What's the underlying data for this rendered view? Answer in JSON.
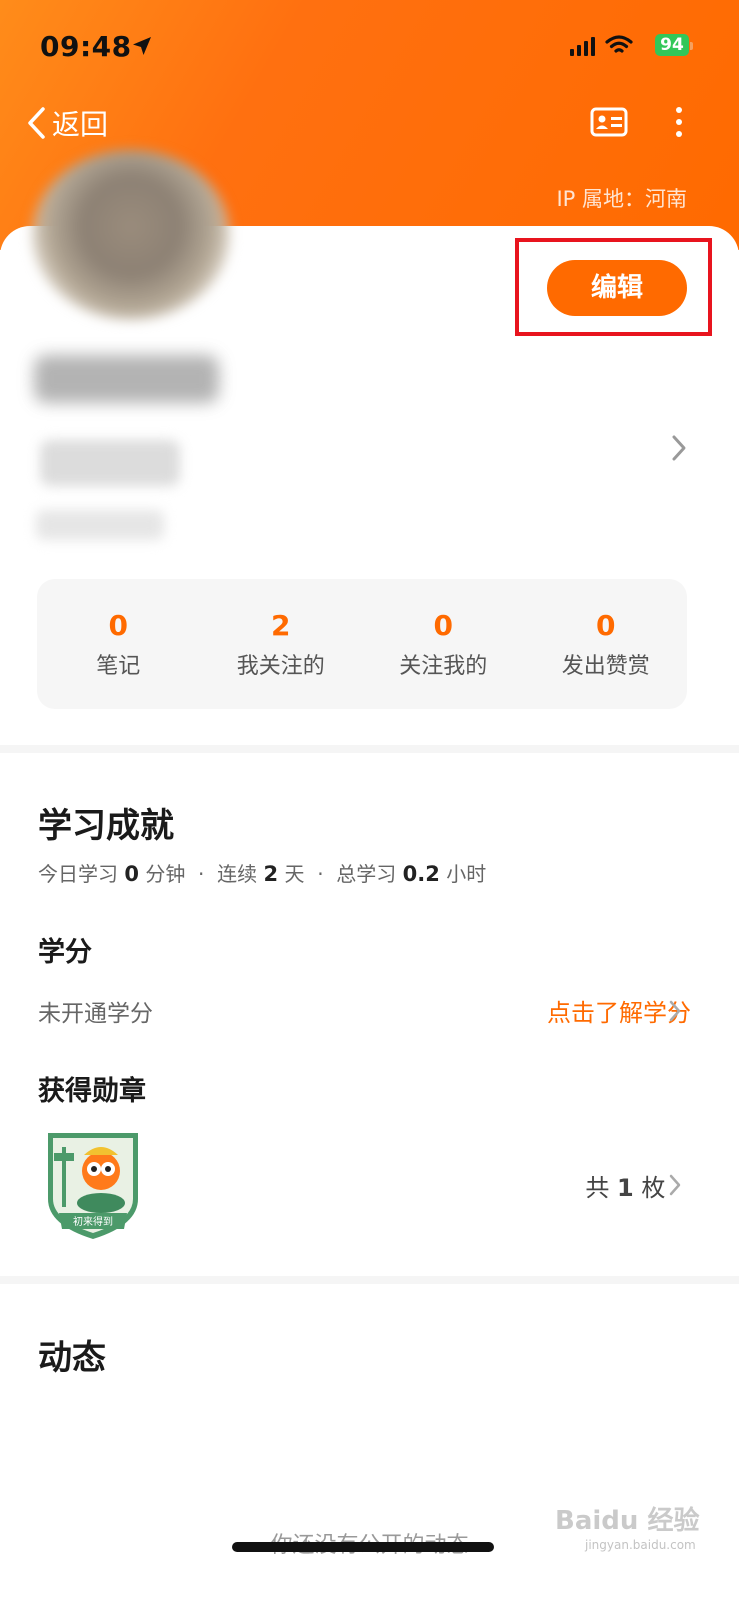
{
  "status": {
    "time": "09:48",
    "battery": "94"
  },
  "nav": {
    "back_label": "返回"
  },
  "profile": {
    "ip_location": "IP 属地：河南",
    "edit_label": "编辑"
  },
  "stats": [
    {
      "value": "0",
      "label": "笔记"
    },
    {
      "value": "2",
      "label": "我关注的"
    },
    {
      "value": "0",
      "label": "关注我的"
    },
    {
      "value": "0",
      "label": "发出赞赏"
    }
  ],
  "achievement": {
    "title": "学习成就",
    "today_label": "今日学习",
    "today_value": "0",
    "today_unit": "分钟",
    "streak_label": "连续",
    "streak_value": "2",
    "streak_unit": "天",
    "total_label": "总学习",
    "total_value": "0.2",
    "total_unit": "小时",
    "credit_title": "学分",
    "credit_status": "未开通学分",
    "credit_link": "点击了解学分",
    "medal_title": "获得勋章",
    "medal_count_prefix": "共",
    "medal_count": "1",
    "medal_count_suffix": "枚",
    "medal_name": "初来得到"
  },
  "feed": {
    "title": "动态",
    "empty_text": "你还没有公开的动态"
  },
  "watermark": {
    "brand": "Baidu 经验",
    "url": "jingyan.baidu.com"
  },
  "colors": {
    "accent": "#ff6a00",
    "highlight_box": "#e8141e"
  }
}
